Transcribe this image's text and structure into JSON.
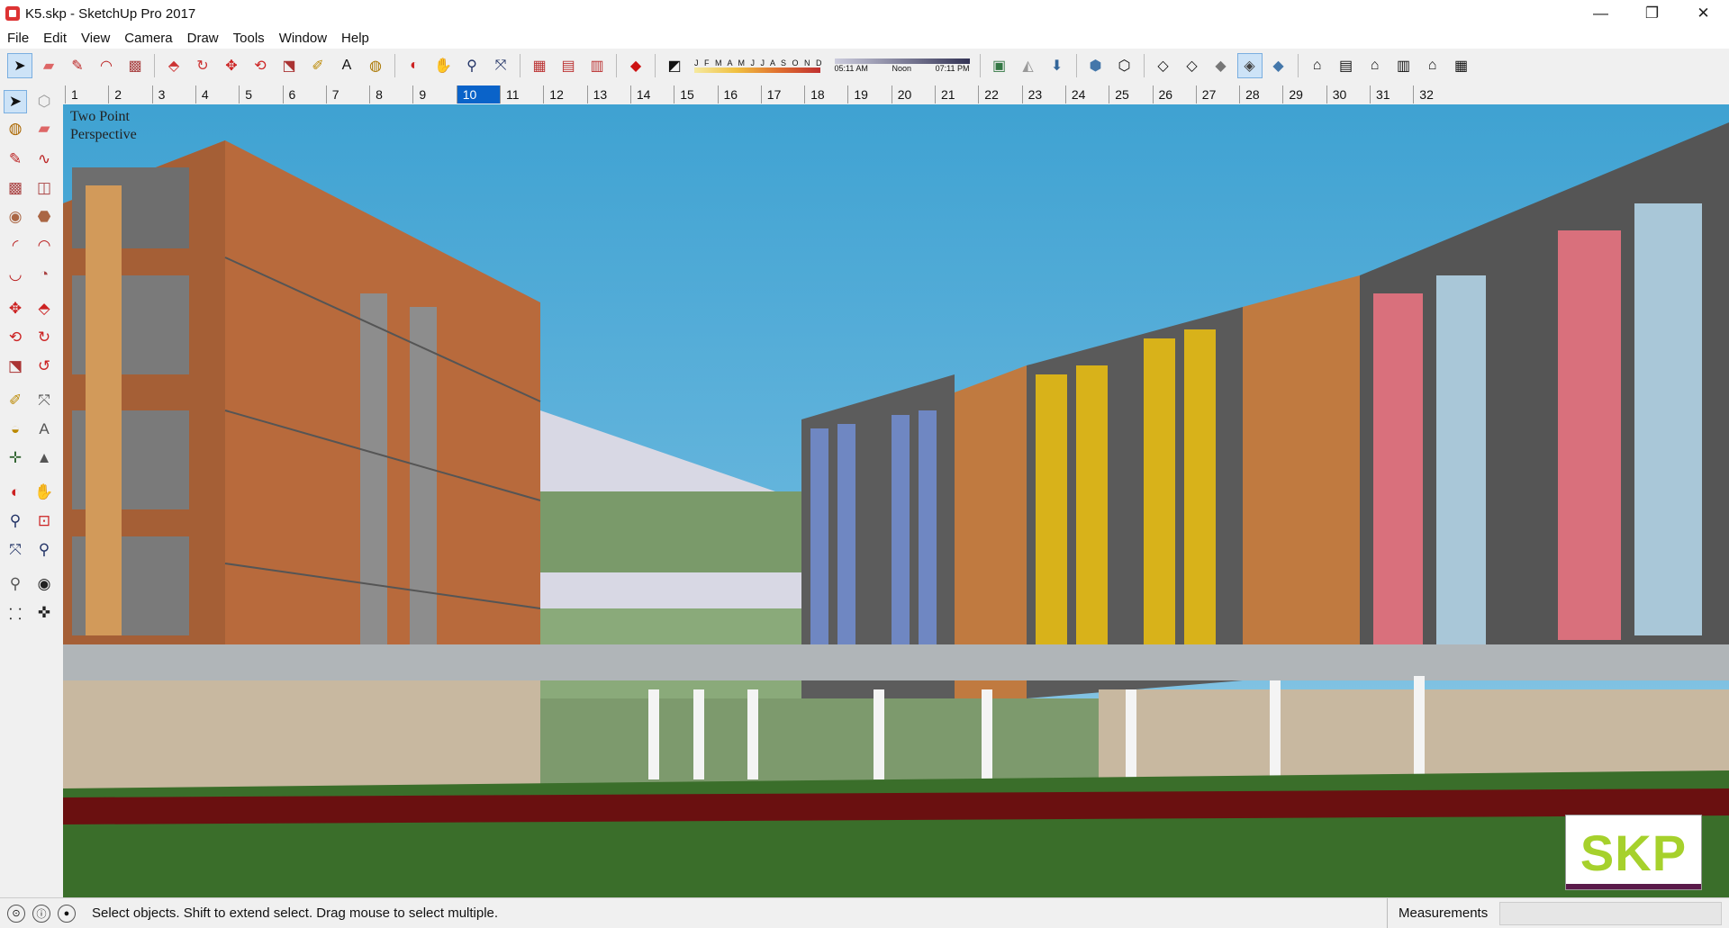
{
  "window": {
    "title": "K5.skp - SketchUp Pro 2017",
    "controls": {
      "minimize": "—",
      "maximize": "❐",
      "close": "✕"
    }
  },
  "menu": [
    "File",
    "Edit",
    "View",
    "Camera",
    "Draw",
    "Tools",
    "Window",
    "Help"
  ],
  "toolbar": {
    "shadow_months": "J F M A M J J A S O N D",
    "time_start": "05:11 AM",
    "time_mid": "Noon",
    "time_end": "07:11 PM"
  },
  "scenes": {
    "tabs": [
      "1",
      "2",
      "3",
      "4",
      "5",
      "6",
      "7",
      "8",
      "9",
      "10",
      "11",
      "12",
      "13",
      "14",
      "15",
      "16",
      "17",
      "18",
      "19",
      "20",
      "21",
      "22",
      "23",
      "24",
      "25",
      "26",
      "27",
      "28",
      "29",
      "30",
      "31",
      "32"
    ],
    "active": "10"
  },
  "viewport": {
    "camera_label_line1": "Two Point",
    "camera_label_line2": "Perspective",
    "watermark": "SKP"
  },
  "status": {
    "message": "Select objects. Shift to extend select. Drag mouse to select multiple.",
    "measurements_label": "Measurements",
    "measurements_value": ""
  },
  "colors": {
    "sky": "#3fa2d2",
    "brick": "#b86a3c",
    "glass_pink": "#d9707c",
    "glass_yellow": "#d8b21a",
    "glass_blue": "#6f87c2",
    "lawn": "#3a6e2a",
    "path": "#6a1010",
    "active_scene": "#0a63c9",
    "skp_logo": "#a6d12c"
  }
}
